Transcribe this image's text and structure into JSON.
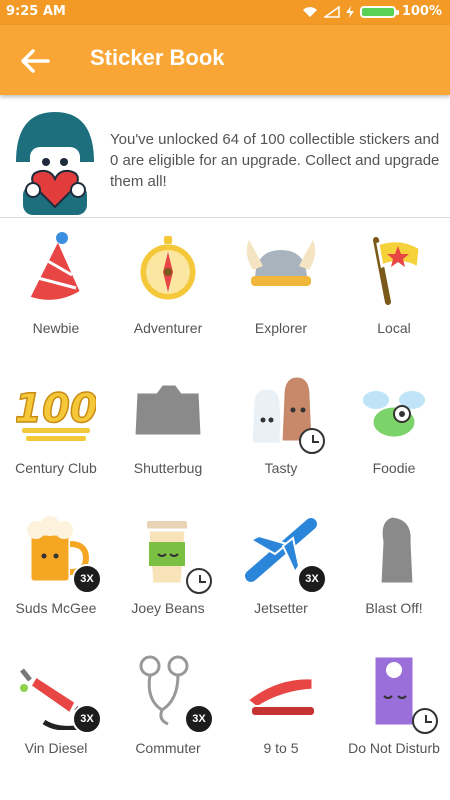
{
  "status": {
    "time": "9:25 AM",
    "battery": "100%"
  },
  "header": {
    "title": "Sticker Book"
  },
  "intro": {
    "text": "You've unlocked 64 of 100 collectible stickers and 0 are eligible for an upgrade. Collect and upgrade them all!"
  },
  "stickers": [
    {
      "label": "Newbie"
    },
    {
      "label": "Adventurer"
    },
    {
      "label": "Explorer"
    },
    {
      "label": "Local"
    },
    {
      "label": "Century Club"
    },
    {
      "label": "Shutterbug"
    },
    {
      "label": "Tasty"
    },
    {
      "label": "Foodie"
    },
    {
      "label": "Suds McGee",
      "badge": "3X"
    },
    {
      "label": "Joey Beans"
    },
    {
      "label": "Jetsetter",
      "badge": "3X"
    },
    {
      "label": "Blast Off!"
    },
    {
      "label": "Vin Diesel",
      "badge": "3X"
    },
    {
      "label": "Commuter",
      "badge": "3X"
    },
    {
      "label": "9 to 5"
    },
    {
      "label": "Do Not Disturb"
    }
  ]
}
